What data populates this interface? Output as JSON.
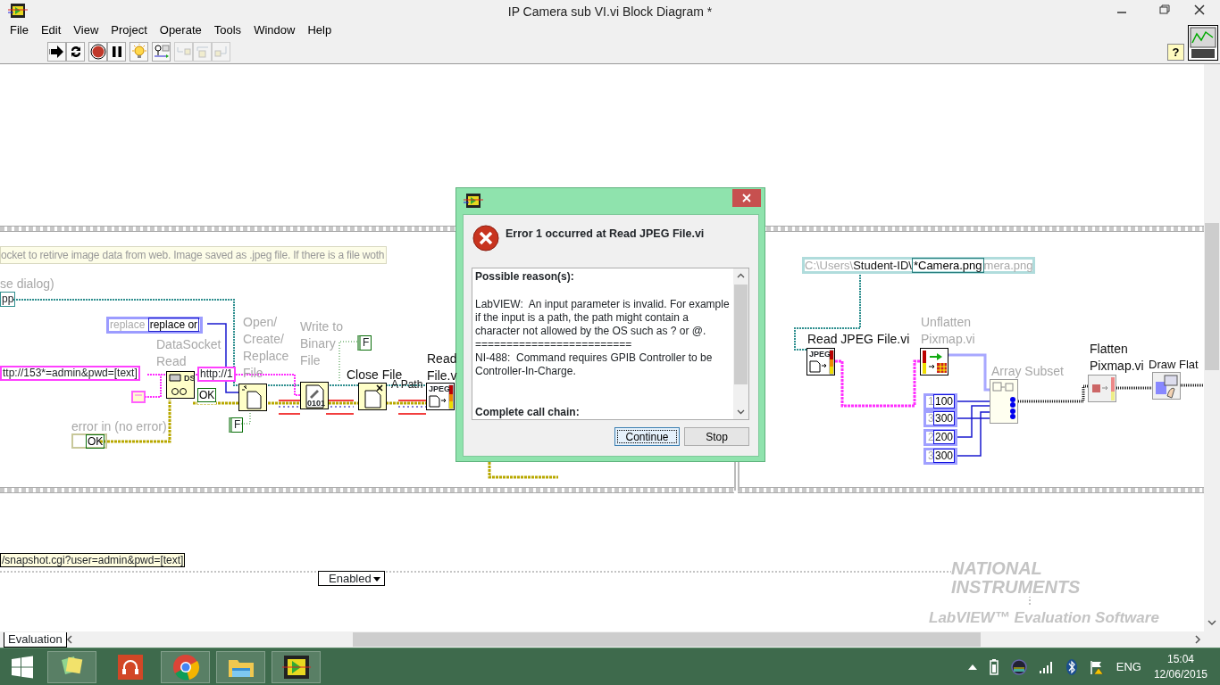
{
  "window": {
    "title": "IP Camera sub VI.vi Block Diagram *"
  },
  "menu": [
    "File",
    "Edit",
    "View",
    "Project",
    "Operate",
    "Tools",
    "Window",
    "Help"
  ],
  "toolbar": [
    {
      "kind": "run",
      "disabled": false
    },
    {
      "kind": "run_continuously",
      "disabled": false
    },
    {
      "kind": "abort",
      "disabled": false
    },
    {
      "kind": "pause",
      "disabled": false
    },
    {
      "kind": "highlight",
      "disabled": false
    },
    {
      "kind": "retain",
      "disabled": false
    },
    {
      "kind": "step_into",
      "disabled": true
    },
    {
      "kind": "step_over",
      "disabled": true
    },
    {
      "kind": "step_out",
      "disabled": true
    }
  ],
  "help_button": "?",
  "diagram": {
    "comment": "ocket to retirve image data from web. Image saved as .jpeg file. If there is a file woth",
    "labels": [
      {
        "kind": "dim",
        "text": "se dialog)"
      },
      {
        "kind": "dim",
        "text": "DataSocket\nRead"
      },
      {
        "kind": "dim",
        "text": "Open/\nCreate/\nReplace\nFile"
      },
      {
        "kind": "dim",
        "text": "Write to\nBinary\nFile"
      },
      {
        "kind": "plain",
        "text": "Close File"
      },
      {
        "kind": "plain",
        "text": "A Path"
      },
      {
        "kind": "plain",
        "text": "Read\nFile.v"
      },
      {
        "kind": "dim",
        "text": "error in (no error)"
      },
      {
        "kind": "plain",
        "text": "Read JPEG File.vi"
      },
      {
        "kind": "dim",
        "text": "Unflatten\nPixmap.vi"
      },
      {
        "kind": "dim",
        "text": "Array Subset"
      },
      {
        "kind": "plain",
        "text": "Flatten\nPixmap.vi"
      },
      {
        "kind": "plain",
        "text": "Draw Flat"
      }
    ],
    "constants": [
      {
        "kind": "path",
        "text": "pp"
      },
      {
        "kind": "enum",
        "label": "replace",
        "text": "replace or"
      },
      {
        "kind": "string",
        "text": "ttp://153*=admin&pwd=[text]"
      },
      {
        "kind": "string",
        "text": "http://1"
      },
      {
        "kind": "error",
        "text": "OK"
      },
      {
        "kind": "status",
        "text": "OK"
      },
      {
        "kind": "boolean",
        "text": "F"
      },
      {
        "kind": "boolean",
        "text": "F"
      },
      {
        "kind": "numeric",
        "hidden": "1",
        "text": "100"
      },
      {
        "kind": "numeric",
        "hidden": "3",
        "text": "300"
      },
      {
        "kind": "numeric",
        "hidden": "2",
        "text": "200"
      },
      {
        "kind": "numeric",
        "hidden": "3",
        "text": "300"
      },
      {
        "kind": "indicator",
        "text": "/snapshot.cgi?user=admin&pwd=[text]"
      }
    ],
    "nodes": [
      {
        "kind": "datasocket_read",
        "icon_text": "DS"
      },
      {
        "kind": "open_file"
      },
      {
        "kind": "write_binary",
        "icon_text": "0101"
      },
      {
        "kind": "close_file"
      },
      {
        "kind": "read_jpeg",
        "icon_text": "JPEG"
      },
      {
        "kind": "read_jpeg",
        "icon_text": "JPEG"
      },
      {
        "kind": "unflatten"
      },
      {
        "kind": "array_subset"
      },
      {
        "kind": "flatten"
      },
      {
        "kind": "draw_flat"
      }
    ],
    "path_constant": {
      "prefix": "C:\\Users\\",
      "folder": "Student-ID\\",
      "value": "*Camera.png",
      "suffix": "mera.png"
    },
    "ring": "Enabled"
  },
  "watermark": {
    "company": "NATIONAL\nINSTRUMENTS",
    "product": "LabVIEW™ Evaluation Software"
  },
  "tab": "Evaluation",
  "dialog": {
    "heading": "Error 1 occurred at Read JPEG File.vi",
    "message": [
      {
        "kind": "heading",
        "text": "Possible reason(s):"
      },
      {
        "kind": "text",
        "text": "LabVIEW:  An input parameter is invalid. For example if the input is a path, the path might contain a character not allowed by the OS such as ? or @."
      },
      {
        "kind": "text",
        "text": "========================="
      },
      {
        "kind": "text",
        "text": "NI-488:  Command requires GPIB Controller to be Controller-In-Charge."
      },
      {
        "kind": "heading",
        "text": "Complete call chain:"
      }
    ],
    "buttons": [
      {
        "label": "Continue",
        "selected": true
      },
      {
        "label": "Stop",
        "selected": false
      }
    ]
  },
  "taskbar": {
    "apps": [
      {
        "kind": "notes",
        "running": true
      },
      {
        "kind": "music",
        "running": false
      },
      {
        "kind": "browser",
        "running": true
      },
      {
        "kind": "explorer",
        "running": true
      },
      {
        "kind": "labview",
        "running": true
      }
    ],
    "language": "ENG",
    "time": "15:04",
    "date": "12/06/2015"
  }
}
